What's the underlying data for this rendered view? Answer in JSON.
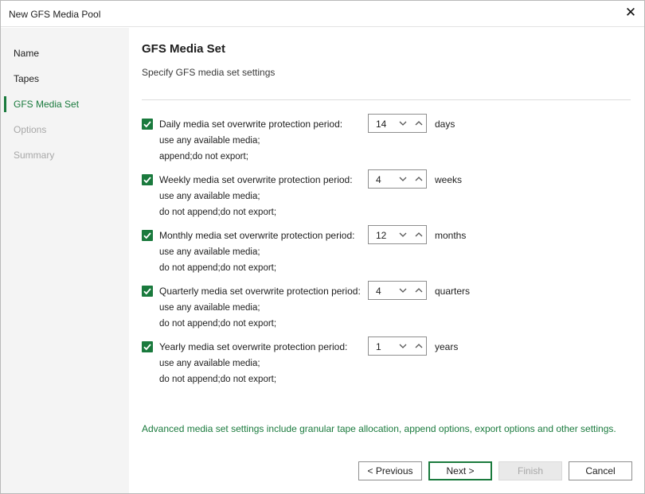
{
  "window": {
    "title": "New GFS Media Pool"
  },
  "sidebar": {
    "items": [
      {
        "label": "Name",
        "state": "normal"
      },
      {
        "label": "Tapes",
        "state": "normal"
      },
      {
        "label": "GFS Media Set",
        "state": "active"
      },
      {
        "label": "Options",
        "state": "disabled"
      },
      {
        "label": "Summary",
        "state": "disabled"
      }
    ]
  },
  "main": {
    "heading": "GFS Media Set",
    "subheading": "Specify GFS media set settings",
    "rows": [
      {
        "label": "Daily media set overwrite protection period:",
        "checked": true,
        "value": "14",
        "unit": "days",
        "desc1": "use any available media;",
        "desc2": "append;do not export;"
      },
      {
        "label": "Weekly media set overwrite protection period:",
        "checked": true,
        "value": "4",
        "unit": "weeks",
        "desc1": "use any available media;",
        "desc2": "do not append;do not export;"
      },
      {
        "label": "Monthly media set overwrite protection period:",
        "checked": true,
        "value": "12",
        "unit": "months",
        "desc1": "use any available media;",
        "desc2": "do not append;do not export;"
      },
      {
        "label": "Quarterly media set overwrite protection period:",
        "checked": true,
        "value": "4",
        "unit": "quarters",
        "desc1": "use any available media;",
        "desc2": "do not append;do not export;"
      },
      {
        "label": "Yearly media set overwrite protection period:",
        "checked": true,
        "value": "1",
        "unit": "years",
        "desc1": "use any available media;",
        "desc2": "do not append;do not export;"
      }
    ],
    "advanced_link": "Advanced media set settings include granular tape allocation, append options, export options and other settings."
  },
  "footer": {
    "previous": "< Previous",
    "next": "Next >",
    "finish": "Finish",
    "cancel": "Cancel"
  },
  "colors": {
    "accent": "#1a7a3d",
    "sidebar_bg": "#f4f4f4",
    "disabled_text": "#a8a8a8"
  },
  "icons": {
    "close": "close-icon",
    "checkbox": "check-icon",
    "spin_down": "chevron-down-icon",
    "spin_up": "chevron-up-icon"
  }
}
